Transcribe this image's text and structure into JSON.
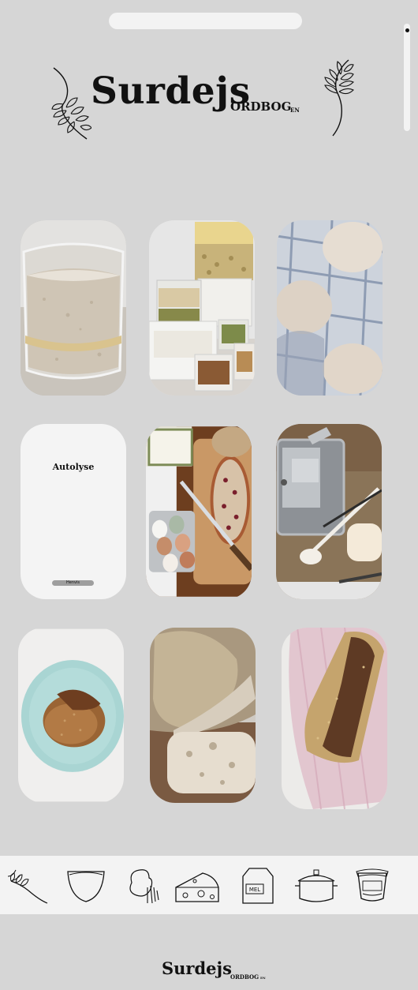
{
  "header": {
    "title": "Surdejs",
    "subtitle": "ORDBOG",
    "lang": "EN"
  },
  "grid": {
    "tiles": [
      {
        "name": "starter-jar",
        "image": "sourdough starter in glass jar"
      },
      {
        "name": "flour-containers",
        "image": "flour and grain containers"
      },
      {
        "name": "dough-proofing",
        "image": "dough balls in towels"
      },
      {
        "name": "autolyse-card",
        "title": "Autolyse",
        "button": "Henvis"
      },
      {
        "name": "cranberry-bread",
        "image": "bread with eggs and knife"
      },
      {
        "name": "baking-tools",
        "image": "bread tin and baking tools"
      },
      {
        "name": "bread-roll",
        "image": "roll on blue plate"
      },
      {
        "name": "sliced-loaf",
        "image": "sliced sourdough loaf"
      },
      {
        "name": "rye-loaf",
        "image": "loaf on pink towel"
      }
    ]
  },
  "toolbar": {
    "items": [
      {
        "icon": "wheat-icon"
      },
      {
        "icon": "bowl-icon"
      },
      {
        "icon": "dough-hand-icon"
      },
      {
        "icon": "cheese-icon"
      },
      {
        "icon": "flour-bag-icon",
        "label": "MEL"
      },
      {
        "icon": "dutch-oven-icon"
      },
      {
        "icon": "jar-icon"
      }
    ]
  },
  "footer": {
    "title": "Surdejs",
    "subtitle": "ORDBOG",
    "lang": "EN"
  }
}
